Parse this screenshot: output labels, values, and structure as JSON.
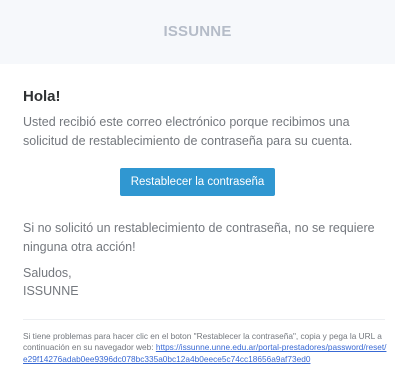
{
  "header": {
    "brand": "ISSUNNE"
  },
  "content": {
    "greeting": "Hola!",
    "intro": "Usted recibió este correo electrónico porque recibimos una solicitud de restablecimiento de contraseña para su cuenta.",
    "button_label": "Restablecer la contraseña",
    "no_action": "Si no solicitó un restablecimiento de contraseña, no se requiere ninguna otra acción!",
    "salutation": "Saludos,",
    "signature": "ISSUNNE"
  },
  "subcopy": {
    "text": "Si tiene problemas para hacer clic en el boton \"Restablecer la contraseña\", copia y pega la URL a continuación en su navegador web: ",
    "link": "https://issunne.unne.edu.ar/portal-prestadores/password/reset/e29f14276adab0ee9396dc078bc335a0bc12a4b0eece5c74cc18656a9af73ed0"
  },
  "colors": {
    "button": "#3097d1",
    "link": "#3869d4",
    "brand": "#b5bcc8",
    "header_bg": "#f6f8fb",
    "body_text": "#74787e",
    "heading_text": "#2f3133"
  }
}
